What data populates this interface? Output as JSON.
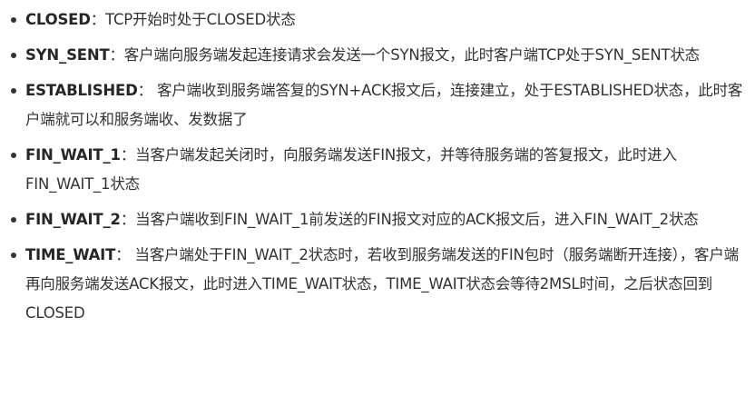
{
  "items": [
    {
      "term": "CLOSED",
      "sep": "：",
      "desc": "TCP开始时处于CLOSED状态"
    },
    {
      "term": "SYN_SENT",
      "sep": "：",
      "desc": "客户端向服务端发起连接请求会发送一个SYN报文，此时客户端TCP处于SYN_SENT状态"
    },
    {
      "term": "ESTABLISHED",
      "sep": "： ",
      "desc": "客户端收到服务端答复的SYN+ACK报文后，连接建立，处于ESTABLISHED状态，此时客户端就可以和服务端收、发数据了"
    },
    {
      "term": "FIN_WAIT_1",
      "sep": "：",
      "desc": "当客户端发起关闭时，向服务端发送FIN报文，并等待服务端的答复报文，此时进入FIN_WAIT_1状态"
    },
    {
      "term": "FIN_WAIT_2",
      "sep": "：",
      "desc": "当客户端收到FIN_WAIT_1前发送的FIN报文对应的ACK报文后，进入FIN_WAIT_2状态"
    },
    {
      "term": "TIME_WAIT",
      "sep": "： ",
      "desc": "当客户端处于FIN_WAIT_2状态时，若收到服务端发送的FIN包时（服务端断开连接），客户端再向服务端发送ACK报文，此时进入TIME_WAIT状态，TIME_WAIT状态会等待2MSL时间，之后状态回到CLOSED"
    }
  ]
}
